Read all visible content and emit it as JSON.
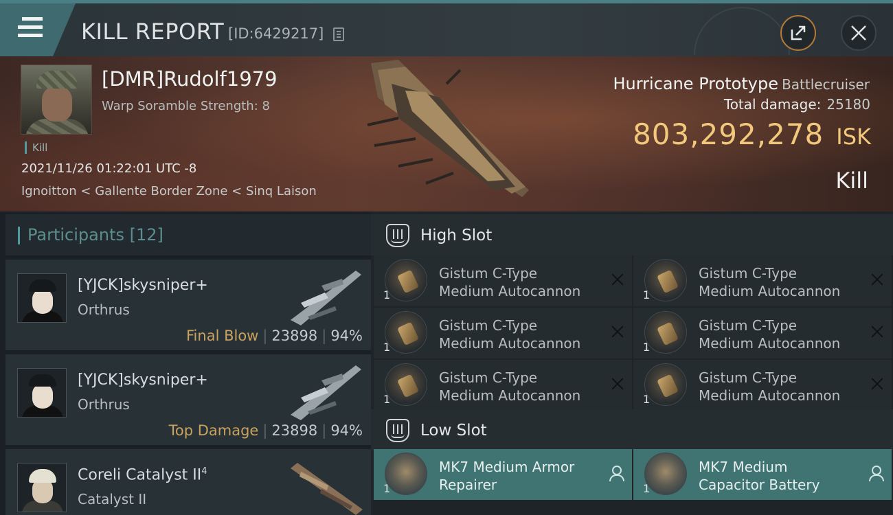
{
  "header": {
    "title": "KILL REPORT",
    "report_id": "[ID:6429217]",
    "icons": {
      "menu": "hamburger-icon",
      "copy": "copy-icon",
      "share": "share-icon",
      "close": "close-icon"
    }
  },
  "victim": {
    "name": "[DMR]Rudolf1979",
    "subtitle": "Warp Soramble Strength: 8",
    "tag": "Kill",
    "timestamp": "2021/11/26 01:22:01 UTC -8",
    "location": "Ignoitton < Gallente Border Zone < Sinq Laison",
    "ship_name": "Hurricane Prototype",
    "ship_class": "Battlecruiser",
    "total_damage_label": "Total damage:",
    "total_damage": "25180",
    "isk_value": "803,292,278",
    "isk_unit": "ISK",
    "result": "Kill"
  },
  "participants": {
    "title": "Participants",
    "count": "[12]",
    "items": [
      {
        "name": "[YJCK]skysniper+",
        "ship": "Orthrus",
        "label": "Final Blow",
        "damage": "23898",
        "percent": "94%"
      },
      {
        "name": "[YJCK]skysniper+",
        "ship": "Orthrus",
        "label": "Top Damage",
        "damage": "23898",
        "percent": "94%"
      },
      {
        "name": "Coreli Catalyst II",
        "name_sup": "4",
        "ship": "Catalyst II"
      }
    ]
  },
  "fittings": {
    "high_slot": {
      "title": "High Slot",
      "modules": [
        {
          "qty": "1",
          "line1": "Gistum C-Type",
          "line2": "Medium Autocannon"
        },
        {
          "qty": "1",
          "line1": "Gistum C-Type",
          "line2": "Medium Autocannon"
        },
        {
          "qty": "1",
          "line1": "Gistum C-Type",
          "line2": "Medium Autocannon"
        },
        {
          "qty": "1",
          "line1": "Gistum C-Type",
          "line2": "Medium Autocannon"
        },
        {
          "qty": "1",
          "line1": "Gistum C-Type",
          "line2": "Medium Autocannon"
        },
        {
          "qty": "1",
          "line1": "Gistum C-Type",
          "line2": "Medium Autocannon"
        }
      ]
    },
    "low_slot": {
      "title": "Low Slot",
      "modules": [
        {
          "qty": "1",
          "line1": "MK7 Medium Armor",
          "line2": "Repairer"
        },
        {
          "qty": "1",
          "line1": "MK7 Medium",
          "line2": "Capacitor Battery"
        }
      ]
    }
  },
  "colors": {
    "accent_teal": "#4f9c9e",
    "isk_gold": "#f2c97c",
    "label_gold": "#c9a25e",
    "active_module": "#3f7473"
  }
}
